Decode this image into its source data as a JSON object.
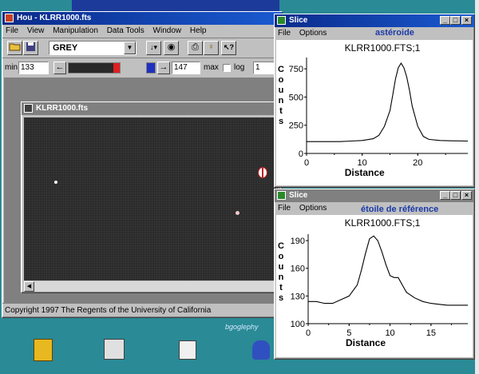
{
  "main_window": {
    "title": "Hou - KLRR1000.fts",
    "menu": [
      "File",
      "View",
      "Manipulation",
      "Data Tools",
      "Window",
      "Help"
    ],
    "palette_value": "GREY",
    "min_label": "min",
    "min_value": "133",
    "max_value": "147",
    "max_label": "max",
    "log_label": "log",
    "log_value": "1",
    "copyright": "Copyright 1997 The Regents of the University of California"
  },
  "image_window": {
    "title": "KLRR1000.fts"
  },
  "slice_top": {
    "title": "Slice",
    "menu": [
      "File",
      "Options"
    ],
    "annotation": "astéroide",
    "chart_data": {
      "type": "line",
      "title": "KLRR1000.FTS;1",
      "xlabel": "Distance",
      "ylabel": "Counts",
      "xlim": [
        0,
        29
      ],
      "ylim": [
        0,
        850
      ],
      "xticks": [
        0,
        10,
        20
      ],
      "yticks": [
        0,
        250,
        500,
        750
      ],
      "x": [
        0,
        2,
        4,
        6,
        8,
        10,
        12,
        13,
        14,
        15,
        15.5,
        16,
        16.5,
        17,
        17.5,
        18,
        18.5,
        19,
        20,
        21,
        22,
        24,
        26,
        29
      ],
      "y": [
        105,
        105,
        105,
        105,
        110,
        115,
        130,
        160,
        240,
        380,
        520,
        660,
        760,
        800,
        760,
        680,
        560,
        420,
        240,
        150,
        125,
        115,
        112,
        110
      ]
    }
  },
  "slice_bottom": {
    "title": "Slice",
    "menu": [
      "File",
      "Options"
    ],
    "annotation": "étoile de référence",
    "chart_data": {
      "type": "line",
      "title": "KLRR1000.FTS;1",
      "xlabel": "Distance",
      "ylabel": "Counts",
      "xlim": [
        0,
        19.5
      ],
      "ylim": [
        100,
        197
      ],
      "xticks": [
        0,
        5,
        10,
        15
      ],
      "yticks": [
        100,
        130,
        160,
        190
      ],
      "x": [
        0,
        1,
        2,
        3,
        4,
        5,
        6,
        6.5,
        7,
        7.5,
        8,
        8.5,
        9,
        9.5,
        10,
        10.5,
        11,
        11.5,
        12,
        13,
        14,
        15,
        16,
        17,
        18,
        19.5
      ],
      "y": [
        124,
        124,
        122,
        122,
        126,
        130,
        142,
        158,
        176,
        192,
        195,
        190,
        178,
        164,
        152,
        150,
        150,
        142,
        134,
        128,
        124,
        122,
        121,
        120,
        120,
        120
      ]
    }
  },
  "desktop": {
    "caption": "bgoglephy"
  }
}
